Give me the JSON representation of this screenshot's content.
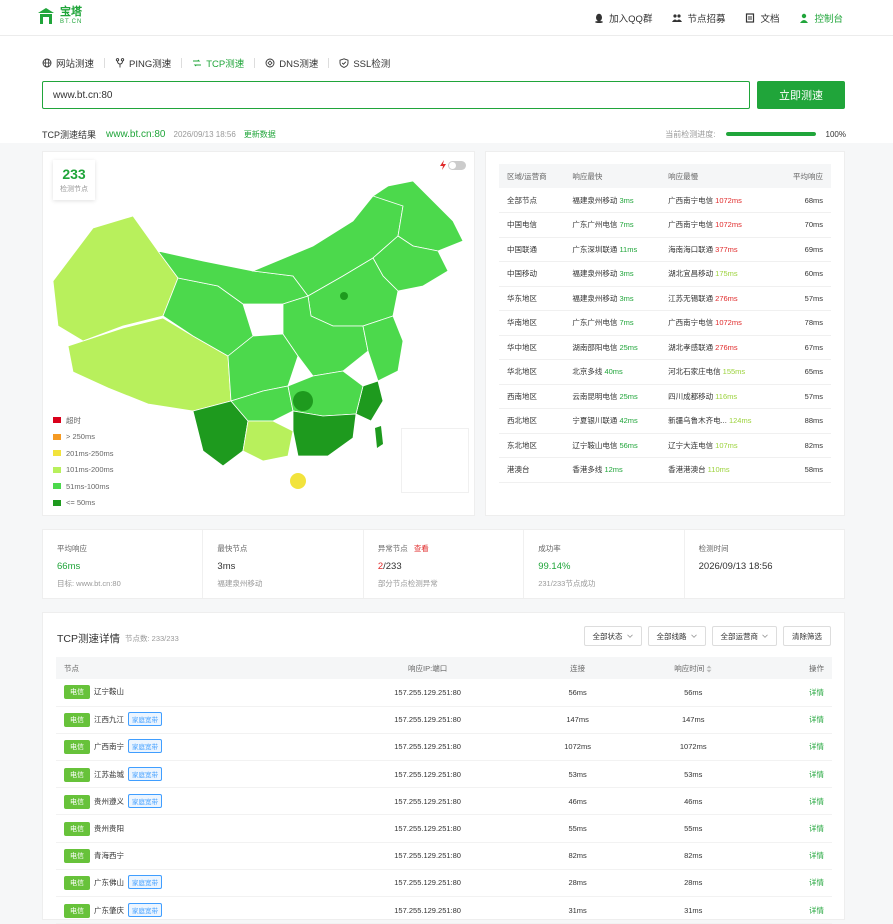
{
  "brand": {
    "name_cn": "宝塔",
    "name_en": "BT.CN"
  },
  "topnav": [
    {
      "label": "加入QQ群",
      "icon": "qq-icon"
    },
    {
      "label": "节点招募",
      "icon": "people-icon"
    },
    {
      "label": "文档",
      "icon": "book-icon"
    },
    {
      "label": "控制台",
      "icon": "user-icon"
    }
  ],
  "tabs": [
    {
      "label": "网站测速",
      "icon": "globe-icon",
      "active": false
    },
    {
      "label": "PING测速",
      "icon": "fork-icon",
      "active": false
    },
    {
      "label": "TCP测速",
      "icon": "link-icon",
      "active": true
    },
    {
      "label": "DNS测速",
      "icon": "dns-icon",
      "active": false
    },
    {
      "label": "SSL检测",
      "icon": "shield-icon",
      "active": false
    }
  ],
  "search": {
    "value": "www.bt.cn:80",
    "button": "立即测速"
  },
  "result": {
    "title": "TCP测速结果",
    "url": "www.bt.cn:80",
    "time": "2026/09/13 18:56",
    "refresh": "更新数据",
    "progress_label": "当前检测进度:",
    "progress": 100,
    "progress_text": "100%"
  },
  "map": {
    "count": "233",
    "count_label": "检测节点",
    "legend": [
      {
        "label": "超时",
        "color": "#d9001b"
      },
      {
        "label": "> 250ms",
        "color": "#f59a23"
      },
      {
        "label": "201ms-250ms",
        "color": "#f2e33c"
      },
      {
        "label": "101ms-200ms",
        "color": "#b8f05c"
      },
      {
        "label": "51ms-100ms",
        "color": "#4cd94c"
      },
      {
        "label": "<= 50ms",
        "color": "#1e9a1e"
      }
    ]
  },
  "isp_table": {
    "headers": [
      "区域/运营商",
      "响应最快",
      "响应最慢",
      "平均响应"
    ],
    "rows": [
      {
        "region": "全部节点",
        "fast_node": "福建泉州移动",
        "fast_ms": "3ms",
        "slow_node": "广西南宁电信",
        "slow_ms": "1072ms",
        "slow_cls": "red",
        "avg": "68ms"
      },
      {
        "region": "中国电信",
        "fast_node": "广东广州电信",
        "fast_ms": "7ms",
        "slow_node": "广西南宁电信",
        "slow_ms": "1072ms",
        "slow_cls": "red",
        "avg": "70ms"
      },
      {
        "region": "中国联通",
        "fast_node": "广东深圳联通",
        "fast_ms": "11ms",
        "slow_node": "海南海口联通",
        "slow_ms": "377ms",
        "slow_cls": "red",
        "avg": "69ms"
      },
      {
        "region": "中国移动",
        "fast_node": "福建泉州移动",
        "fast_ms": "3ms",
        "slow_node": "湖北宜昌移动",
        "slow_ms": "175ms",
        "slow_cls": "light",
        "avg": "60ms"
      },
      {
        "region": "华东地区",
        "fast_node": "福建泉州移动",
        "fast_ms": "3ms",
        "slow_node": "江苏无锡联通",
        "slow_ms": "276ms",
        "slow_cls": "red",
        "avg": "57ms"
      },
      {
        "region": "华南地区",
        "fast_node": "广东广州电信",
        "fast_ms": "7ms",
        "slow_node": "广西南宁电信",
        "slow_ms": "1072ms",
        "slow_cls": "red",
        "avg": "78ms"
      },
      {
        "region": "华中地区",
        "fast_node": "湖南邵阳电信",
        "fast_ms": "25ms",
        "slow_node": "湖北孝感联通",
        "slow_ms": "276ms",
        "slow_cls": "red",
        "avg": "67ms"
      },
      {
        "region": "华北地区",
        "fast_node": "北京多线",
        "fast_ms": "40ms",
        "slow_node": "河北石家庄电信",
        "slow_ms": "155ms",
        "slow_cls": "light",
        "avg": "65ms"
      },
      {
        "region": "西南地区",
        "fast_node": "云南昆明电信",
        "fast_ms": "25ms",
        "slow_node": "四川成都移动",
        "slow_ms": "116ms",
        "slow_cls": "light",
        "avg": "57ms"
      },
      {
        "region": "西北地区",
        "fast_node": "宁夏银川联通",
        "fast_ms": "42ms",
        "slow_node": "新疆乌鲁木齐电...",
        "slow_ms": "124ms",
        "slow_cls": "light",
        "avg": "88ms"
      },
      {
        "region": "东北地区",
        "fast_node": "辽宁鞍山电信",
        "fast_ms": "56ms",
        "slow_node": "辽宁大连电信",
        "slow_ms": "107ms",
        "slow_cls": "light",
        "avg": "82ms"
      },
      {
        "region": "港澳台",
        "fast_node": "香港多线",
        "fast_ms": "12ms",
        "slow_node": "香港港澳台",
        "slow_ms": "110ms",
        "slow_cls": "light",
        "avg": "58ms"
      }
    ]
  },
  "stats": [
    {
      "label": "平均响应",
      "value": "66ms",
      "value_cls": "g",
      "sub": "目标: www.bt.cn:80"
    },
    {
      "label": "最快节点",
      "value": "3ms",
      "value_cls": "",
      "sub": "福建泉州移动"
    },
    {
      "label": "异常节点",
      "view": "查看",
      "value_a": "2",
      "value_b": "/233",
      "sub": "部分节点检测异常"
    },
    {
      "label": "成功率",
      "value": "99.14%",
      "value_cls": "g",
      "sub": "231/233节点成功"
    },
    {
      "label": "检测时间",
      "value": "2026/09/13 18:56",
      "value_cls": "",
      "sub": ""
    }
  ],
  "detail": {
    "title": "TCP测速详情",
    "count": "节点数: 233/233",
    "filters": [
      "全部状态",
      "全部线路",
      "全部运营商",
      "清除筛选"
    ],
    "headers": [
      "节点",
      "响应IP:端口",
      "连接",
      "响应时间",
      "操作"
    ],
    "rows": [
      {
        "isp": "电信",
        "node": "辽宁鞍山",
        "tag": "",
        "ip": "157.255.129.251:80",
        "conn": "56ms",
        "resp": "56ms",
        "resp_cls": "g",
        "op": "详情"
      },
      {
        "isp": "电信",
        "node": "江西九江",
        "tag": "家庭宽带",
        "ip": "157.255.129.251:80",
        "conn": "147ms",
        "resp": "147ms",
        "resp_cls": "l",
        "op": "详情"
      },
      {
        "isp": "电信",
        "node": "广西南宁",
        "tag": "家庭宽带",
        "ip": "157.255.129.251:80",
        "conn": "1072ms",
        "resp": "1072ms",
        "resp_cls": "r",
        "op": "详情"
      },
      {
        "isp": "电信",
        "node": "江苏盐城",
        "tag": "家庭宽带",
        "ip": "157.255.129.251:80",
        "conn": "53ms",
        "resp": "53ms",
        "resp_cls": "g",
        "op": "详情"
      },
      {
        "isp": "电信",
        "node": "贵州遵义",
        "tag": "家庭宽带",
        "ip": "157.255.129.251:80",
        "conn": "46ms",
        "resp": "46ms",
        "resp_cls": "g",
        "op": "详情"
      },
      {
        "isp": "电信",
        "node": "贵州贵阳",
        "tag": "",
        "ip": "157.255.129.251:80",
        "conn": "55ms",
        "resp": "55ms",
        "resp_cls": "g",
        "op": "详情"
      },
      {
        "isp": "电信",
        "node": "青海西宁",
        "tag": "",
        "ip": "157.255.129.251:80",
        "conn": "82ms",
        "resp": "82ms",
        "resp_cls": "g",
        "op": "详情"
      },
      {
        "isp": "电信",
        "node": "广东佛山",
        "tag": "家庭宽带",
        "ip": "157.255.129.251:80",
        "conn": "28ms",
        "resp": "28ms",
        "resp_cls": "g",
        "op": "详情"
      },
      {
        "isp": "电信",
        "node": "广东肇庆",
        "tag": "家庭宽带",
        "ip": "157.255.129.251:80",
        "conn": "31ms",
        "resp": "31ms",
        "resp_cls": "g",
        "op": "详情"
      }
    ]
  },
  "colors": {
    "brand": "#20a53a",
    "danger": "#e02b2b",
    "light": "#9bd23a",
    "info": "#409eff"
  }
}
